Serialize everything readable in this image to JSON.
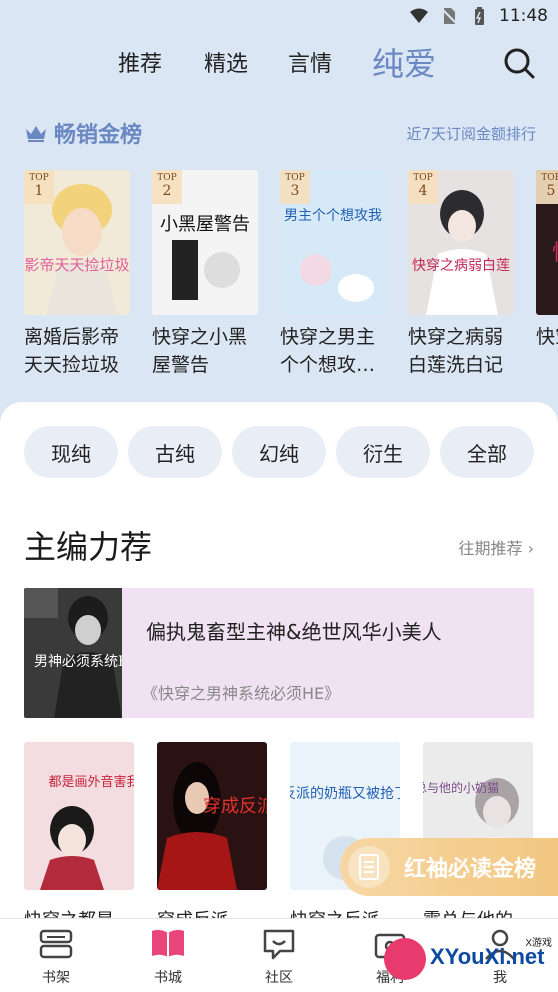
{
  "status_bar": {
    "time": "11:48",
    "icons": [
      "wifi-icon",
      "no-sim-icon",
      "battery-icon"
    ]
  },
  "top_nav": {
    "tabs": [
      {
        "label": "推荐",
        "active": false
      },
      {
        "label": "精选",
        "active": false
      },
      {
        "label": "言情",
        "active": false
      },
      {
        "label": "纯爱",
        "active": true
      }
    ],
    "search_icon": "search-icon"
  },
  "ranking": {
    "title": "畅销金榜",
    "link": "近7天订阅金额排行",
    "badge_top": "TOP",
    "books": [
      {
        "rank": "1",
        "name": "离婚后影帝天天捡垃圾",
        "cover_text": "影帝天天捡垃圾"
      },
      {
        "rank": "2",
        "name": "快穿之小黑屋警告",
        "cover_text": "小黑屋警告"
      },
      {
        "rank": "3",
        "name": "快穿之男主个个想攻…",
        "cover_text": "男主个个想攻我"
      },
      {
        "rank": "4",
        "name": "快穿之病弱白莲洗白记",
        "cover_text": "快穿之病弱白莲"
      },
      {
        "rank": "5",
        "name": "快穿之救",
        "cover_text": "快"
      }
    ]
  },
  "categories": [
    "现纯",
    "古纯",
    "幻纯",
    "衍生",
    "全部"
  ],
  "editor_picks": {
    "title": "主编力荐",
    "link": "往期推荐",
    "feature": {
      "headline": "偏执鬼畜型主神&绝世风华小美人",
      "subtitle": "《快穿之男神系统必须HE》",
      "cover_text": "男神必须系统HE"
    },
    "books": [
      {
        "name": "快穿之都是",
        "cover_text": "都是画外音害我"
      },
      {
        "name": "穿成反派",
        "cover_text": "穿成反派"
      },
      {
        "name": "快穿之反派",
        "cover_text": "反派的奶瓶又被抢了"
      },
      {
        "name": "霸总与他的",
        "cover_text": "霸总与他的小奶猫"
      }
    ]
  },
  "float_banner": {
    "label": "红袖必读金榜"
  },
  "tab_bar": {
    "items": [
      {
        "label": "书架",
        "icon": "bookshelf-icon",
        "active": false
      },
      {
        "label": "书城",
        "icon": "book-store-icon",
        "active": true
      },
      {
        "label": "社区",
        "icon": "community-icon",
        "active": false
      },
      {
        "label": "福利",
        "icon": "gift-icon",
        "active": false
      },
      {
        "label": "我",
        "icon": "profile-icon",
        "active": false
      }
    ]
  },
  "watermark": {
    "text": "XYouXi.net",
    "small": "X游戏"
  },
  "colors": {
    "accent": "#6a88c2",
    "background": "#dbe6f4",
    "feature_bg": "#f0e2f2",
    "tab_active": "#e8457a"
  }
}
